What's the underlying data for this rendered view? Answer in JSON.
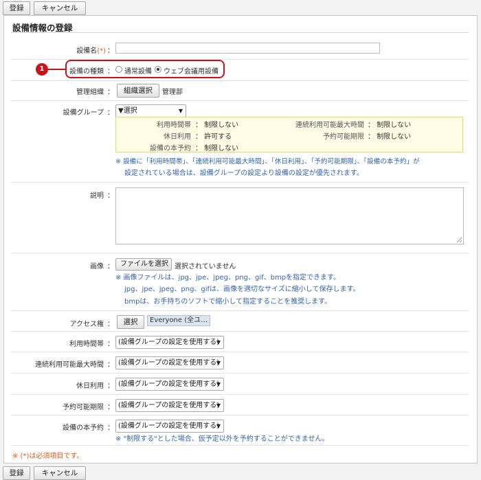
{
  "toolbar": {
    "register": "登録",
    "cancel": "キャンセル"
  },
  "form": {
    "title": "設備情報の登録",
    "name": {
      "label": "設備名",
      "required_mark": "(*)",
      "colon": "：",
      "value": ""
    },
    "type": {
      "label": "設備の種類",
      "options": [
        "通常設備",
        "ウェブ会議用設備"
      ],
      "selected": "ウェブ会議用設備",
      "badge": "1"
    },
    "org": {
      "label": "管理組織",
      "button": "組織選択",
      "value": "管理部"
    },
    "group": {
      "label": "設備グループ",
      "select_value": "▼選択",
      "details": [
        {
          "label": "利用時間帯",
          "value": "制限しない"
        },
        {
          "label": "連続利用可能最大時間",
          "value": "制限しない"
        },
        {
          "label": "休日利用",
          "value": "許可する"
        },
        {
          "label": "予約可能期限",
          "value": "制限しない"
        },
        {
          "label": "設備の本予約",
          "value": "制限しない"
        }
      ],
      "note_line1": "※ 設備に「利用時間帯」、「連続利用可能最大時間」、「休日利用」、「予約可能期限」、「設備の本予約」が",
      "note_line2": "設定されている場合は、設備グループの設定より設備の設定が優先されます。"
    },
    "description": {
      "label": "説明",
      "value": ""
    },
    "image": {
      "label": "画像",
      "button": "ファイルを選択",
      "status": "選択されていません",
      "note_line1": "※ 画像ファイルは、jpg、jpe、jpeg、png、gif、bmpを指定できます。",
      "note_line2": "jpg、jpe、jpeg、png、gifは、画像を適切なサイズに縮小して保存します。",
      "note_line3": "bmpは、お手持ちのソフトで縮小して指定することを推奨します。"
    },
    "access": {
      "label": "アクセス権",
      "button": "選択",
      "value": "Everyone (全ユ…"
    },
    "usage_time": {
      "label": "利用時間帯",
      "value": "(設備グループの設定を使用する)"
    },
    "max_time": {
      "label": "連続利用可能最大時間",
      "value": "(設備グループの設定を使用する)"
    },
    "holiday": {
      "label": "休日利用",
      "value": "(設備グループの設定を使用する)"
    },
    "limit": {
      "label": "予約可能期限",
      "value": "(設備グループの設定を使用する)"
    },
    "booking": {
      "label": "設備の本予約",
      "value": "(設備グループの設定を使用する)",
      "note": "※ \"制限する\"とした場合、仮予定以外を予約することができません。"
    },
    "required_note": "※ (*)は必須項目です。"
  },
  "colors": {
    "required": "#e05a1c",
    "note": "#3264b4",
    "callout": "#c8131a",
    "group_bg": "#fffde6"
  }
}
